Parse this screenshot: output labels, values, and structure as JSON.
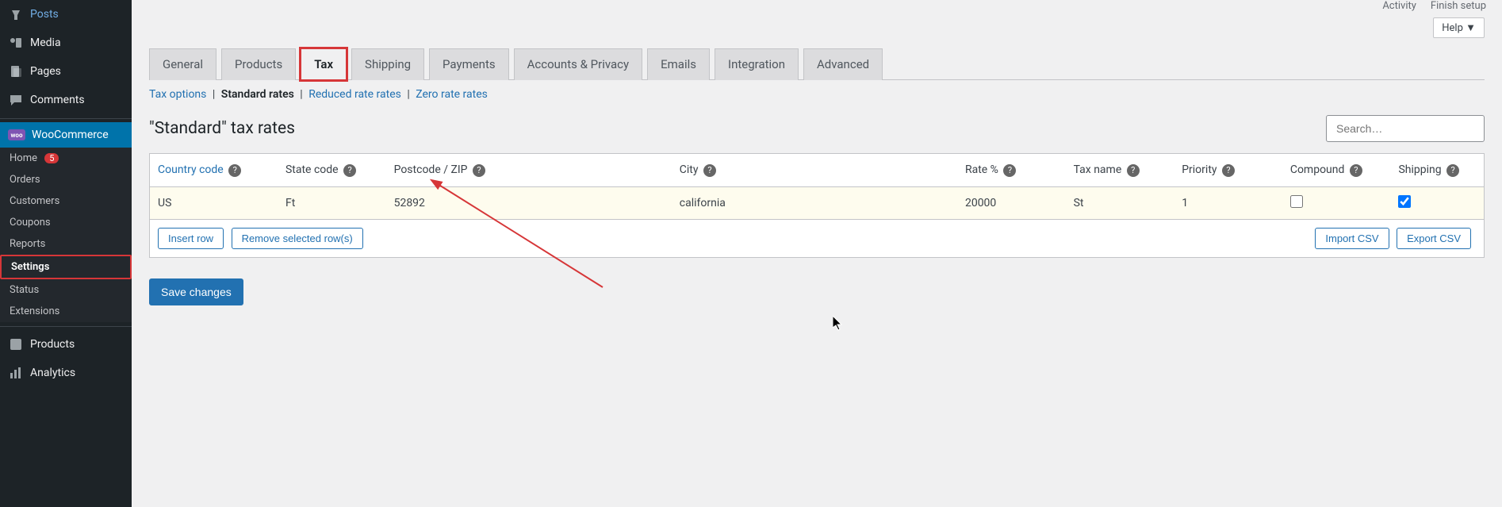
{
  "top_bar": {
    "activity": "Activity",
    "finish": "Finish setup"
  },
  "help": {
    "label": "Help ▼"
  },
  "sidebar": {
    "items": [
      {
        "icon": "pin",
        "label": "Posts"
      },
      {
        "icon": "media",
        "label": "Media"
      },
      {
        "icon": "pages",
        "label": "Pages"
      },
      {
        "icon": "comments",
        "label": "Comments"
      }
    ],
    "woo_label": "WooCommerce",
    "woo_sub": [
      {
        "label": "Home",
        "badge": "5"
      },
      {
        "label": "Orders"
      },
      {
        "label": "Customers"
      },
      {
        "label": "Coupons"
      },
      {
        "label": "Reports"
      },
      {
        "label": "Settings",
        "selected": true
      },
      {
        "label": "Status"
      },
      {
        "label": "Extensions"
      }
    ],
    "products_label": "Products",
    "analytics_label": "Analytics"
  },
  "tabs": [
    "General",
    "Products",
    "Tax",
    "Shipping",
    "Payments",
    "Accounts & Privacy",
    "Emails",
    "Integration",
    "Advanced"
  ],
  "active_tab": 2,
  "subtabs": {
    "items": [
      "Tax options",
      "Standard rates",
      "Reduced rate rates",
      "Zero rate rates"
    ],
    "current": 1
  },
  "page_title": "\"Standard\" tax rates",
  "search_placeholder": "Search…",
  "table": {
    "headers": [
      "Country code",
      "State code",
      "Postcode / ZIP",
      "City",
      "Rate %",
      "Tax name",
      "Priority",
      "Compound",
      "Shipping"
    ],
    "row": {
      "country": "US",
      "state": "Ft",
      "postcode": "52892",
      "city": "california",
      "rate": "20000",
      "name": "St",
      "priority": "1",
      "compound": false,
      "shipping": true
    },
    "buttons": {
      "insert": "Insert row",
      "remove": "Remove selected row(s)",
      "import": "Import CSV",
      "export": "Export CSV"
    }
  },
  "save_label": "Save changes"
}
